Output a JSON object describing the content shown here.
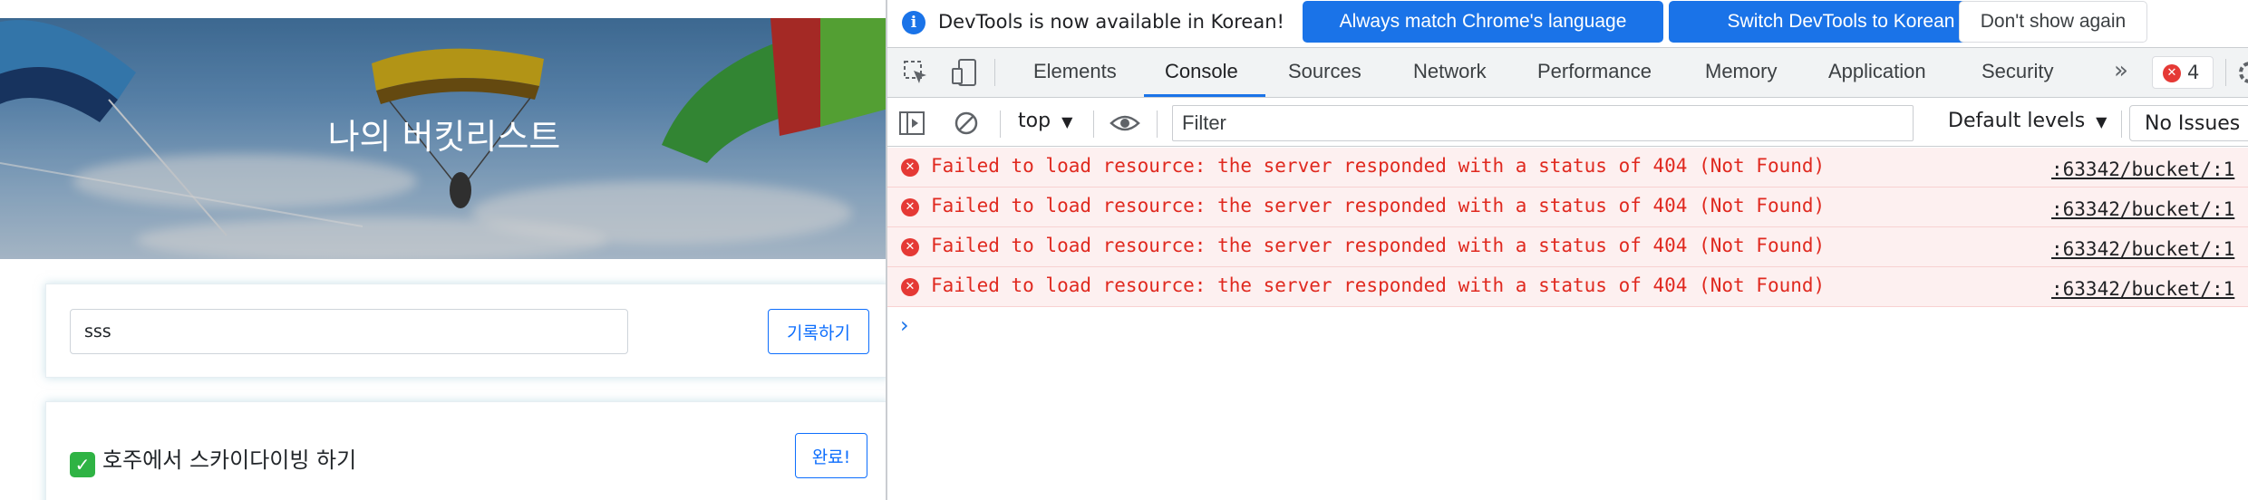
{
  "page": {
    "hero_title": "나의 버킷리스트",
    "input_value": "sss",
    "record_button": "기록하기",
    "bucket_items": [
      {
        "text": "호주에서 스카이다이빙 하기",
        "checked": true,
        "button": "완료!"
      }
    ]
  },
  "devtools": {
    "infobar": {
      "message": "DevTools is now available in Korean!",
      "buttons": [
        "Always match Chrome's language",
        "Switch DevTools to Korean",
        "Don't show again"
      ]
    },
    "tabs": [
      "Elements",
      "Console",
      "Sources",
      "Network",
      "Performance",
      "Memory",
      "Application",
      "Security"
    ],
    "active_tab": "Console",
    "issues_count": "4",
    "toolbar": {
      "context": "top",
      "filter_placeholder": "Filter",
      "levels": "Default levels",
      "issues": "No Issues"
    },
    "console_messages": [
      {
        "level": "error",
        "text": "Failed to load resource: the server responded with a status of 404 (Not Found)",
        "source": ":63342/bucket/:1"
      },
      {
        "level": "error",
        "text": "Failed to load resource: the server responded with a status of 404 (Not Found)",
        "source": ":63342/bucket/:1"
      },
      {
        "level": "error",
        "text": "Failed to load resource: the server responded with a status of 404 (Not Found)",
        "source": ":63342/bucket/:1"
      },
      {
        "level": "error",
        "text": "Failed to load resource: the server responded with a status of 404 (Not Found)",
        "source": ":63342/bucket/:1"
      }
    ],
    "prompt_symbol": "›"
  },
  "colors": {
    "accent": "#1a73e8",
    "error_text": "#e0291f",
    "error_bg": "#fdf0f0",
    "bootstrap_primary": "#0d6efd"
  }
}
